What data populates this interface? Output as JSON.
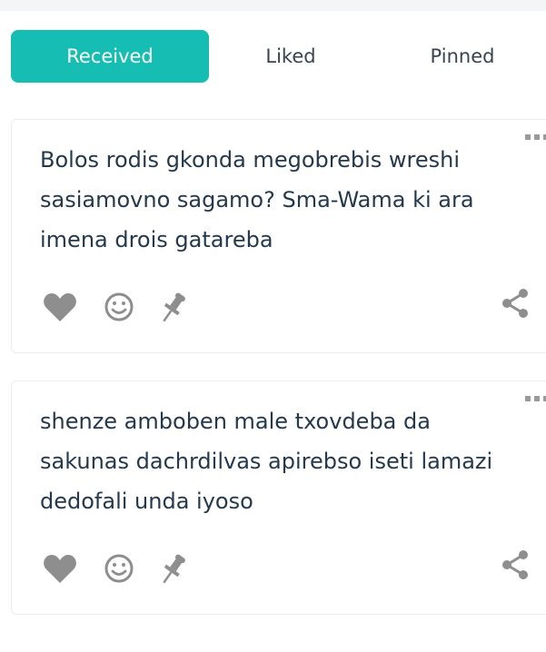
{
  "tabs": [
    {
      "label": "Received",
      "active": true
    },
    {
      "label": "Liked",
      "active": false
    },
    {
      "label": "Pinned",
      "active": false
    }
  ],
  "colors": {
    "accent": "#15bdb3",
    "text": "#25394d",
    "icon": "#8e8e8e"
  },
  "messages": [
    {
      "text": "Bolos rodis gkonda megobrebis wreshi sasiamovno sagamo? Sma-Wama ki ara imena drois gatareba"
    },
    {
      "text": "shenze amboben male txovdeba da sakunas dachrdilvas apirebso iseti lamazi dedofali unda iyoso"
    }
  ],
  "icons": {
    "more": "more-dots-icon",
    "like": "heart-icon",
    "react": "smiley-icon",
    "pin": "pushpin-icon",
    "share": "share-icon"
  }
}
